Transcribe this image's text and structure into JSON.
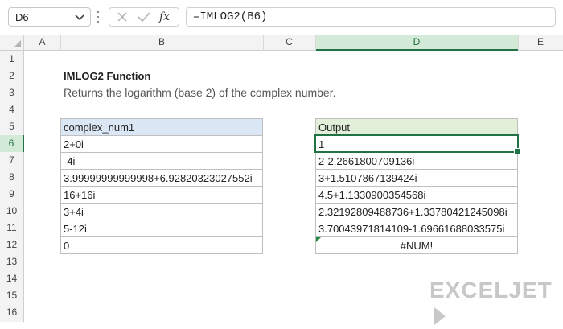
{
  "formula_bar": {
    "name_box": "D6",
    "fx_label": "fx",
    "formula": "=IMLOG2(B6)"
  },
  "columns": [
    "A",
    "B",
    "C",
    "D",
    "E"
  ],
  "rows": [
    "1",
    "2",
    "3",
    "4",
    "5",
    "6",
    "7",
    "8",
    "9",
    "10",
    "11",
    "12",
    "13",
    "14",
    "15",
    "16"
  ],
  "title": "IMLOG2 Function",
  "subtitle": "Returns the logarithm (base 2) of the complex number.",
  "input_table": {
    "header": "complex_num1",
    "values": [
      "2+0i",
      "-4i",
      "3.99999999999998+6.92820323027552i",
      "16+16i",
      "3+4i",
      "5-12i",
      "0"
    ]
  },
  "output_table": {
    "header": "Output",
    "values": [
      "1",
      "2-2.2661800709136i",
      "3+1.5107867139424i",
      "4.5+1.1330900354568i",
      "2.32192809488736+1.33780421245098i",
      "3.70043971814109-1.69661688033575i",
      "#NUM!"
    ]
  },
  "selected_cell": "D6",
  "colors": {
    "accent": "#217346",
    "input_header_bg": "#dbe7f5",
    "output_header_bg": "#e2efd9"
  },
  "logo_text": "EXCELJET"
}
